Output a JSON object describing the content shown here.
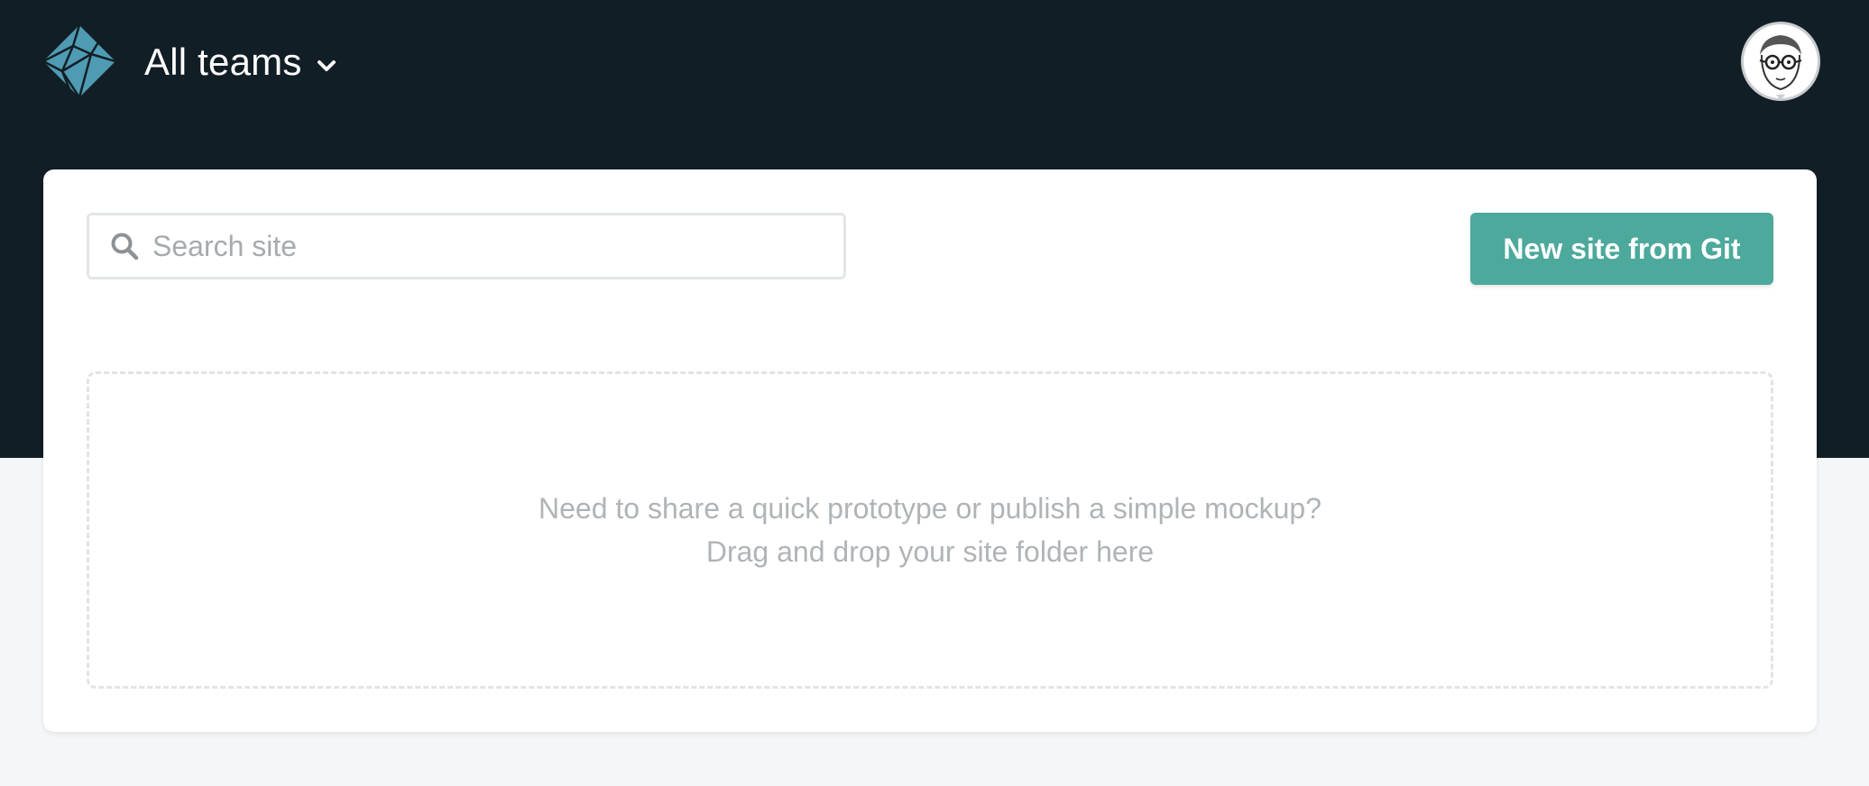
{
  "header": {
    "logo_icon": "netlify-logo-icon",
    "team_selector": {
      "label": "All teams",
      "icon": "chevron-down-icon"
    },
    "avatar_icon": "user-avatar"
  },
  "toolbar": {
    "search": {
      "icon": "search-icon",
      "placeholder": "Search site",
      "value": ""
    },
    "new_site_button": "New site from Git"
  },
  "dropzone": {
    "line1": "Need to share a quick prototype or publish a simple mockup?",
    "line2": "Drag and drop your site folder here"
  },
  "colors": {
    "header_bg": "#121e25",
    "page_bg": "#f4f6f7",
    "accent": "#4ca99c",
    "logo": "#4e9bb3"
  }
}
